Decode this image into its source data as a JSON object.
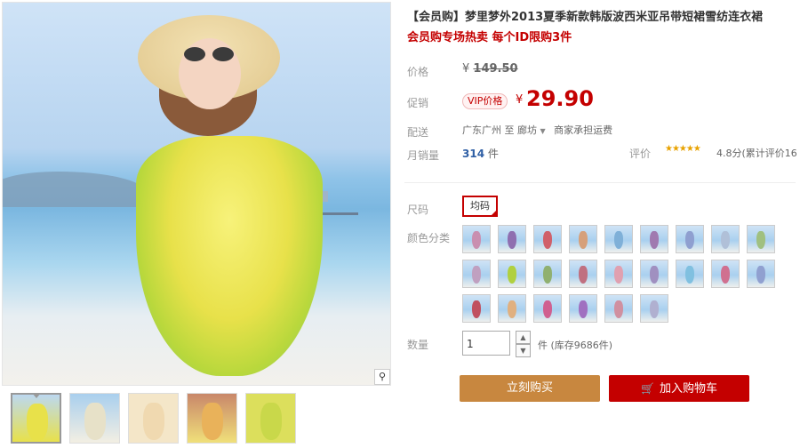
{
  "product": {
    "title": "【会员购】梦里梦外2013夏季新款韩版波西米亚吊带短裙雪纺连衣裙",
    "subtitle": "会员购专场热卖 每个ID限购3件"
  },
  "price": {
    "original_label": "价格",
    "currency": "¥",
    "original_value": "149.50",
    "promo_label": "促销",
    "vip_badge": "VIP价格",
    "promo_value": "29.90"
  },
  "shipping": {
    "label": "配送",
    "from": "广东广州",
    "to_word": "至",
    "to": "廊坊",
    "fee_note": "商家承担运费"
  },
  "sales": {
    "label": "月销量",
    "count": "314",
    "unit": "件"
  },
  "rating": {
    "label": "评价",
    "stars": "★★★★★",
    "text": "4.8分(累计评价16"
  },
  "size": {
    "label": "尺码",
    "selected": "均码"
  },
  "color": {
    "label": "颜色分类",
    "swatch_colors": [
      "#c98fb0",
      "#8f6fb0",
      "#d0606a",
      "#d6a07a",
      "#7fb0d8",
      "#a07ab0",
      "#8f9fd0",
      "#b0c0d8",
      "#a0c080",
      "#c0a0c0",
      "#b0d040",
      "#90b070",
      "#c07080",
      "#e0a0b0",
      "#a090c0",
      "#80c0e0",
      "#d07090",
      "#90a0d0",
      "#c05060",
      "#e0b080",
      "#d06090",
      "#a070c0",
      "#d090a0",
      "#b0b0d0"
    ]
  },
  "quantity": {
    "label": "数量",
    "value": "1",
    "stock": "件 (库存9686件)"
  },
  "actions": {
    "buy_now": "立刻购买",
    "add_cart": "加入购物车"
  },
  "gallery": {
    "thumbs": [
      "#e8e14a",
      "#f3efe3",
      "#f4e6c8",
      "#e9b25a",
      "#dcdf5c"
    ]
  }
}
